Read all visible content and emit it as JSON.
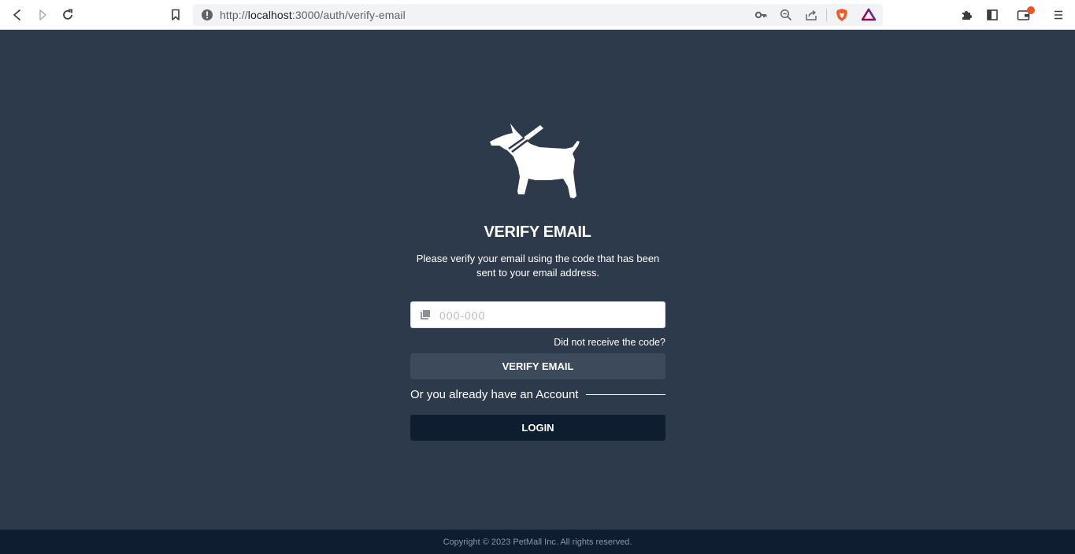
{
  "browser": {
    "url_prefix": "http://",
    "url_host": "localhost",
    "url_rest": ":3000/auth/verify-email",
    "icons": [
      "back-icon",
      "forward-icon",
      "reload-icon",
      "bookmark-icon",
      "info-icon",
      "key-icon",
      "zoom-icon",
      "share-icon",
      "brave-shield-icon",
      "brave-rewards-icon",
      "extensions-icon",
      "sidebar-icon",
      "wallet-icon",
      "menu-icon"
    ]
  },
  "page": {
    "title": "VERIFY EMAIL",
    "subtitle": "Please verify your email using the code that has been sent to your email address.",
    "code_placeholder": "000-000",
    "resend_link": "Did not receive the code?",
    "verify_button": "VERIFY EMAIL",
    "or_text": "Or you already have an Account",
    "login_button": "LOGIN"
  },
  "footer": {
    "copyright": "Copyright © 2023 PetMall Inc. All rights reserved."
  },
  "colors": {
    "background": "#2d3a4b",
    "dark": "#0e1e30",
    "button_verify": "#3c4a5b",
    "badge": "#f1502f"
  }
}
